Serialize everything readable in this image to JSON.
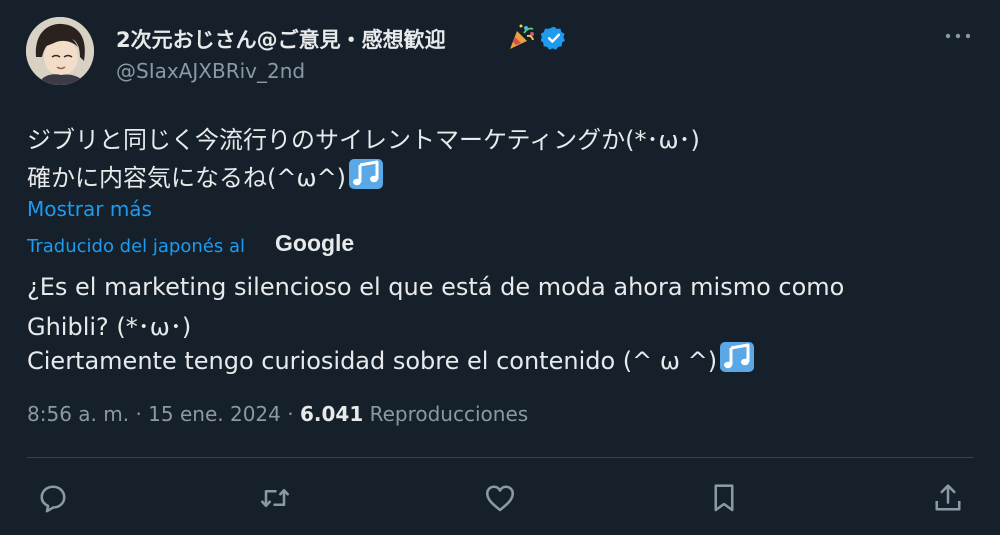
{
  "author": {
    "display_name": "2次元おじさん@ご意見・感想歓迎",
    "handle": "@SIaxAJXBRiv_2nd",
    "verified": true
  },
  "tweet": {
    "original_lines": [
      "ジブリと同じく今流行りのサイレントマーケティングか(*･ω･)",
      "確かに内容気になるね(^ω^)"
    ],
    "show_more": "Mostrar más",
    "translated_by": "Traducido del japonés al",
    "translator_brand": "Google",
    "translation_lines": [
      "¿Es el marketing silencioso el que está de moda ahora mismo como",
      "Ghibli? (*･ω･)",
      "Ciertamente tengo curiosidad sobre el contenido (^ ω ^)"
    ],
    "time": "8:56 a. m.",
    "date": "15 ene. 2024",
    "separator": "·",
    "views_count": "6.041",
    "views_label": "Reproducciones"
  },
  "icons": {
    "more": "more-icon",
    "party": "party-popper-icon",
    "verified": "verified-badge-icon",
    "music": "musical-notes-icon",
    "reply": "reply-icon",
    "retweet": "retweet-icon",
    "like": "like-icon",
    "bookmark": "bookmark-icon",
    "share": "share-icon"
  },
  "colors": {
    "background": "#15202b",
    "text": "#e7e9ea",
    "secondary": "#8b98a5",
    "accent": "#1d9bf0",
    "divider": "#38444d",
    "note": "#5aa9e6"
  }
}
